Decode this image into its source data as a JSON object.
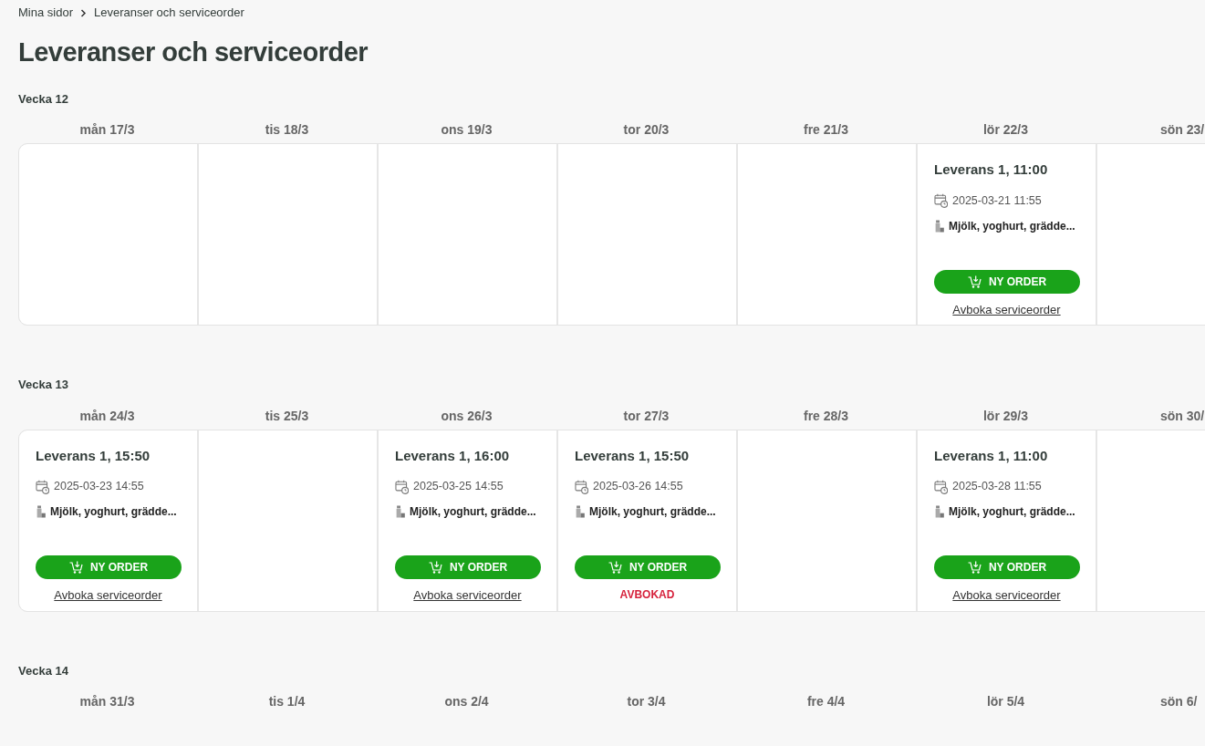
{
  "breadcrumb": [
    {
      "label": "Mina sidor"
    },
    {
      "label": "Leveranser och serviceorder"
    }
  ],
  "title": "Leveranser och serviceorder",
  "weeks": [
    {
      "label": "Vecka 12",
      "cells_visible": true,
      "days": [
        {
          "label": "mån 17/3"
        },
        {
          "label": "tis 18/3"
        },
        {
          "label": "ons 19/3"
        },
        {
          "label": "tor 20/3"
        },
        {
          "label": "fre 21/3"
        },
        {
          "label": "lör 22/3",
          "delivery": {
            "title": "Leverans 1, 11:00",
            "order_time": "2025-03-21 11:55",
            "products": "Mjölk, yoghurt, grädde...",
            "button": "NY ORDER",
            "cancelled": false,
            "footer": "Avboka serviceorder"
          }
        },
        {
          "label": "sön 23/"
        }
      ]
    },
    {
      "label": "Vecka 13",
      "cells_visible": true,
      "days": [
        {
          "label": "mån 24/3",
          "delivery": {
            "title": "Leverans 1, 15:50",
            "order_time": "2025-03-23 14:55",
            "products": "Mjölk, yoghurt, grädde...",
            "button": "NY ORDER",
            "cancelled": false,
            "footer": "Avboka serviceorder"
          }
        },
        {
          "label": "tis 25/3"
        },
        {
          "label": "ons 26/3",
          "delivery": {
            "title": "Leverans 1, 16:00",
            "order_time": "2025-03-25 14:55",
            "products": "Mjölk, yoghurt, grädde...",
            "button": "NY ORDER",
            "cancelled": false,
            "footer": "Avboka serviceorder"
          }
        },
        {
          "label": "tor 27/3",
          "delivery": {
            "title": "Leverans 1, 15:50",
            "order_time": "2025-03-26 14:55",
            "products": "Mjölk, yoghurt, grädde...",
            "button": "NY ORDER",
            "cancelled": true,
            "footer": "AVBOKAD"
          }
        },
        {
          "label": "fre 28/3"
        },
        {
          "label": "lör 29/3",
          "delivery": {
            "title": "Leverans 1, 11:00",
            "order_time": "2025-03-28 11:55",
            "products": "Mjölk, yoghurt, grädde...",
            "button": "NY ORDER",
            "cancelled": false,
            "footer": "Avboka serviceorder"
          }
        },
        {
          "label": "sön 30/"
        }
      ]
    },
    {
      "label": "Vecka 14",
      "cells_visible": false,
      "days": [
        {
          "label": "mån 31/3"
        },
        {
          "label": "tis 1/4"
        },
        {
          "label": "ons 2/4"
        },
        {
          "label": "tor 3/4"
        },
        {
          "label": "fre 4/4"
        },
        {
          "label": "lör 5/4"
        },
        {
          "label": "sön 6/"
        }
      ]
    }
  ]
}
